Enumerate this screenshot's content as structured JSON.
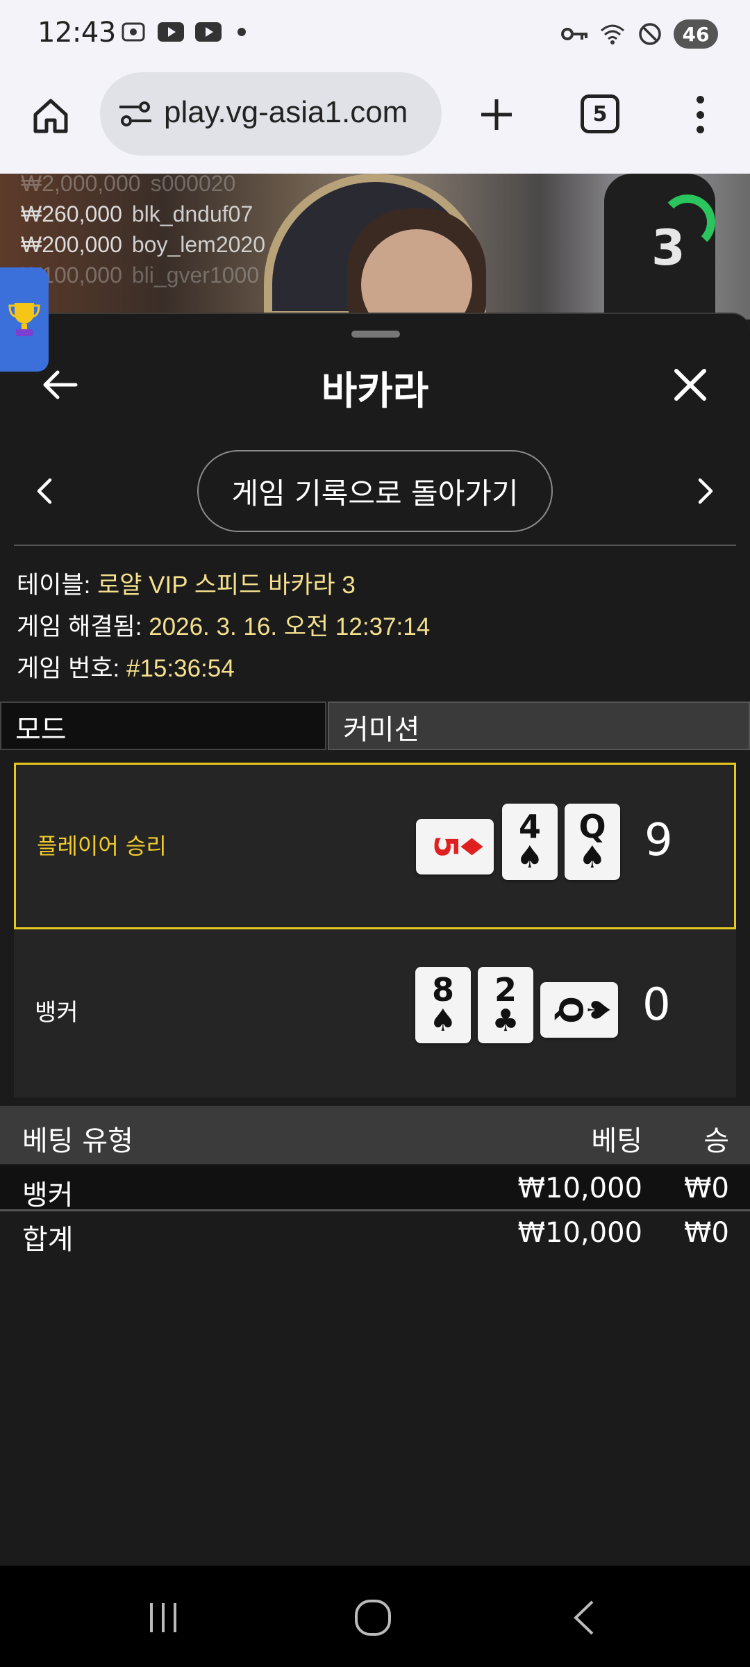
{
  "status_bar": {
    "time": "12:43",
    "left_icons": [
      "screenshot-icon",
      "youtube-icon",
      "youtube-icon"
    ],
    "battery": "46"
  },
  "browser": {
    "url": "play.vg-asia1.com",
    "tab_count": "5"
  },
  "video": {
    "ticker": [
      {
        "amount": "₩2,000,000",
        "user": "s000020"
      },
      {
        "amount": "₩260,000",
        "user": "blk_dnduf07"
      },
      {
        "amount": "₩200,000",
        "user": "boy_lem2020"
      },
      {
        "amount": "₩100,000",
        "user": "bli_gver1000"
      }
    ],
    "countdown": "3"
  },
  "sheet": {
    "title": "바카라",
    "return_button": "게임 기록으로 돌아가기",
    "table_label": "테이블: ",
    "table_value": "로얄 VIP 스피드 바카라 3",
    "resolved_label": "게임 해결됨: ",
    "resolved_value": "2026. 3. 16. 오전 12:37:14",
    "game_no_label": "게임 번호: ",
    "game_no_value": "#15:36:54",
    "mode_label": "모드",
    "commission_label": "커미션"
  },
  "result": {
    "player": {
      "label": "플레이어 승리",
      "score": "9",
      "cards": [
        {
          "rank": "5",
          "suit": "♦",
          "color": "#e02020",
          "rotated": true
        },
        {
          "rank": "4",
          "suit": "♠",
          "color": "#111111",
          "rotated": false
        },
        {
          "rank": "Q",
          "suit": "♠",
          "color": "#111111",
          "rotated": false
        }
      ]
    },
    "banker": {
      "label": "뱅커",
      "score": "0",
      "cards": [
        {
          "rank": "8",
          "suit": "♠",
          "color": "#111111",
          "rotated": false
        },
        {
          "rank": "2",
          "suit": "♣",
          "color": "#111111",
          "rotated": false
        },
        {
          "rank": "Q",
          "suit": "♠",
          "color": "#111111",
          "rotated": true
        }
      ]
    }
  },
  "bets": {
    "headers": {
      "type": "베팅 유형",
      "bet": "베팅",
      "win": "승"
    },
    "rows": [
      {
        "type": "뱅커",
        "bet": "₩10,000",
        "win": "₩0"
      }
    ],
    "total": {
      "type": "합계",
      "bet": "₩10,000",
      "win": "₩0"
    }
  },
  "colors": {
    "accent_yellow": "#e8c81e",
    "value_text": "#f5e08e",
    "sheet_bg": "#1b1b1b"
  }
}
